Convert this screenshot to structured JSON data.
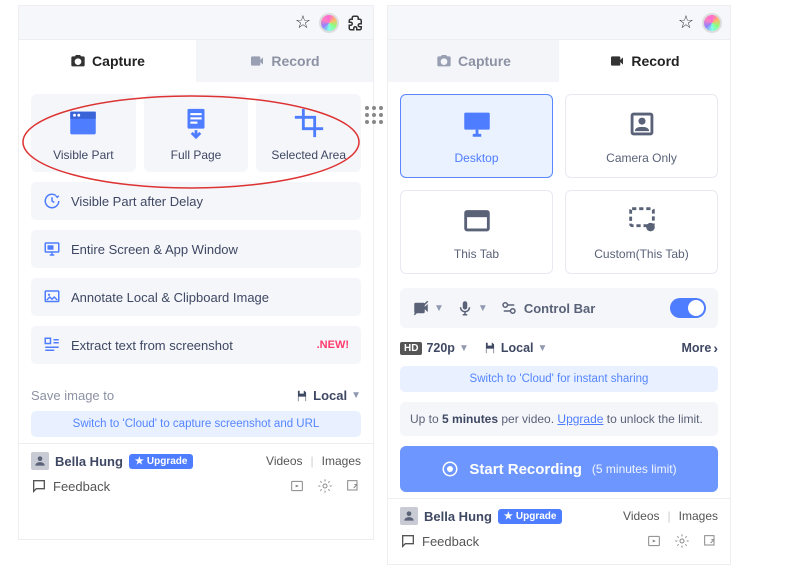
{
  "left": {
    "tabs": {
      "capture": "Capture",
      "record": "Record"
    },
    "tiles": {
      "visible_part": "Visible Part",
      "full_page": "Full Page",
      "selected_area": "Selected Area"
    },
    "list": {
      "delay": "Visible Part after Delay",
      "entire": "Entire Screen & App Window",
      "annotate": "Annotate Local & Clipboard Image",
      "extract": "Extract text from screenshot",
      "new_tag": ".NEW!"
    },
    "saveto": {
      "label": "Save image to",
      "target": "Local"
    },
    "cloud_tip": "Switch to 'Cloud' to capture screenshot and URL",
    "user": {
      "name": "Bella Hung",
      "upgrade": "Upgrade"
    },
    "footer_links": {
      "videos": "Videos",
      "images": "Images",
      "feedback": "Feedback"
    }
  },
  "right": {
    "tabs": {
      "capture": "Capture",
      "record": "Record"
    },
    "tiles": {
      "desktop": "Desktop",
      "camera": "Camera Only",
      "thistab": "This Tab",
      "custom": "Custom(This Tab)"
    },
    "toolbar": {
      "control_bar": "Control Bar"
    },
    "quality": {
      "res": "720p",
      "target": "Local",
      "more": "More"
    },
    "cloud_tip": "Switch to 'Cloud' for instant sharing",
    "limit": {
      "pre": "Up to ",
      "bold": "5 minutes",
      "mid": " per video. ",
      "link": "Upgrade",
      "post": " to unlock the limit."
    },
    "record_btn": {
      "label": "Start Recording",
      "sub": "(5 minutes limit)"
    },
    "user": {
      "name": "Bella Hung",
      "upgrade": "Upgrade"
    },
    "footer_links": {
      "videos": "Videos",
      "images": "Images",
      "feedback": "Feedback"
    }
  }
}
